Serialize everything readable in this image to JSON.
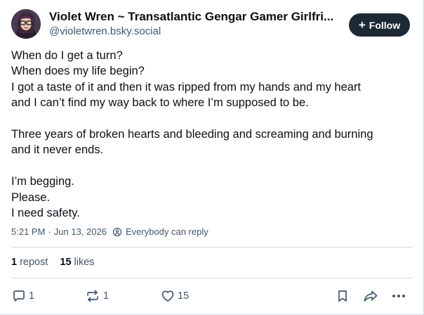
{
  "author": {
    "display_name": "Violet Wren ~ Transatlantic Gengar Gamer Girlfri...",
    "handle": "@violetwren.bsky.social",
    "avatar_icon": "avatar-photo"
  },
  "follow_button": {
    "icon": "plus-icon",
    "label": "Follow"
  },
  "post": {
    "paragraphs": [
      [
        "When do I get a turn?",
        "When does my life begin?",
        "I got a taste of it and then it was ripped from my hands and my heart",
        "and I can’t find my way back to where I’m supposed to be."
      ],
      [
        "Three years of broken hearts and bleeding and screaming and burning",
        "and it never ends."
      ],
      [
        "I’m begging.",
        "Please.",
        "I need safety."
      ]
    ]
  },
  "meta": {
    "time": "5:21 PM",
    "separator": "·",
    "date": "Jun 13, 2026",
    "reply_setting": "Everybody can reply"
  },
  "stats": {
    "reposts_count": "1",
    "reposts_label": "repost",
    "likes_count": "15",
    "likes_label": "likes"
  },
  "actions": {
    "reply_count": "1",
    "repost_count": "1",
    "like_count": "15"
  },
  "colors": {
    "text": "#0b0f14",
    "muted": "#42576c",
    "follow_bg": "#1e2936",
    "divider": "#d4dbe2"
  }
}
